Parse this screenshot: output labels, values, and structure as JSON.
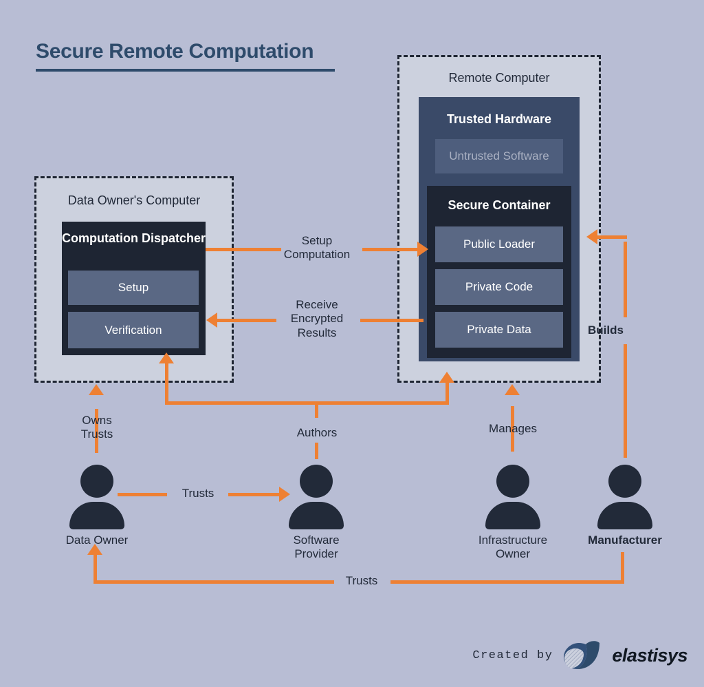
{
  "page": {
    "title": "Secure Remote Computation",
    "accent_color": "#ee8033",
    "background_color": "#b8bdd4",
    "title_color": "#2e4b6b",
    "dark_block_color": "#1e2533",
    "mid_block_color": "#3a4a68",
    "inner_box_color": "#5a6884"
  },
  "left_panel": {
    "title": "Data Owner's Computer",
    "block_heading": "Computation\nDispatcher",
    "items": [
      {
        "label": "Setup"
      },
      {
        "label": "Verification"
      }
    ]
  },
  "right_panel": {
    "title": "Remote Computer",
    "hardware_heading": "Trusted Hardware",
    "untrusted_label": "Untrusted Software",
    "container_heading": "Secure Container",
    "items": [
      {
        "label": "Public Loader"
      },
      {
        "label": "Private Code"
      },
      {
        "label": "Private Data"
      }
    ]
  },
  "edges": {
    "setup_computation": "Setup\nComputation",
    "receive_encrypted_results": "Receive\nEncrypted\nResults",
    "owns_trusts": "Owns\nTrusts",
    "authors": "Authors",
    "manages": "Manages",
    "builds": "Builds",
    "trusts_horizontal": "Trusts",
    "trusts_bottom": "Trusts"
  },
  "actors": [
    {
      "name": "Data Owner"
    },
    {
      "name": "Software\nProvider"
    },
    {
      "name": "Infrastructure\nOwner"
    },
    {
      "name": "Manufacturer"
    }
  ],
  "footer": {
    "created_by": "Created by",
    "brand": "elastisys"
  }
}
